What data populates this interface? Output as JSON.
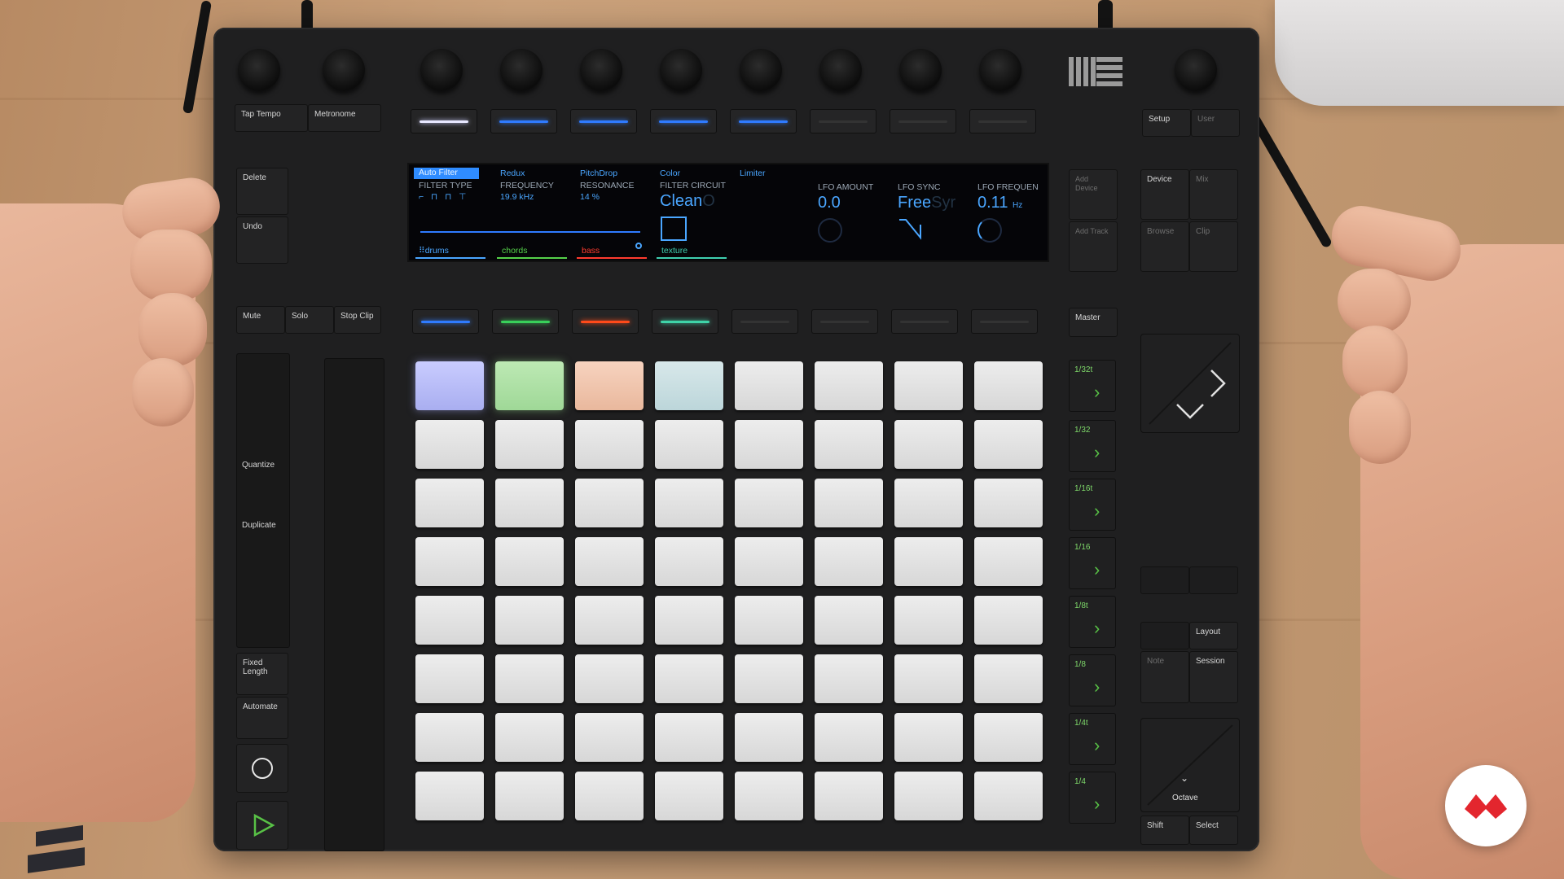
{
  "controller": {
    "top_left_buttons": [
      "Tap Tempo",
      "Metronome"
    ],
    "top_right_buttons": [
      "Setup",
      "User"
    ],
    "left_buttons": [
      "Delete",
      "Undo",
      "Quantize",
      "Duplicate",
      "Fixed Length",
      "Automate"
    ],
    "track_buttons": [
      "Mute",
      "Solo",
      "Stop Clip"
    ],
    "right_buttons": {
      "add_device": "Add Device",
      "add_track": "Add Track",
      "device": "Device",
      "mix": "Mix",
      "browse": "Browse",
      "clip": "Clip",
      "master": "Master",
      "layout": "Layout",
      "note": "Note",
      "session": "Session",
      "octave": "Octave",
      "shift": "Shift",
      "select": "Select"
    },
    "scene_buttons": [
      "1/32t",
      "1/32",
      "1/16t",
      "1/16",
      "1/8t",
      "1/8",
      "1/4t",
      "1/4"
    ],
    "upper_strip_colors": [
      "#e8e8ff",
      "#2f7bff",
      "#2f7bff",
      "#2f7bff",
      "#2f7bff",
      "#333333",
      "#333333",
      "#333333"
    ],
    "lower_strip_colors": [
      "#2f7bff",
      "#39d05a",
      "#ff4a1a",
      "#3fd3a8",
      "#333333",
      "#333333",
      "#333333",
      "#333333"
    ],
    "pad_tints": [
      "#b9bdf6",
      "#a9dea3",
      "#f2c7ae",
      "#c6dbe0"
    ],
    "accent_green": "#58c146"
  },
  "screen": {
    "devices": [
      "Auto Filter",
      "Redux",
      "PitchDrop",
      "Color",
      "Limiter"
    ],
    "params": [
      {
        "label": "FILTER TYPE",
        "value": ""
      },
      {
        "label": "FREQUENCY",
        "value": "19.9 kHz"
      },
      {
        "label": "RESONANCE",
        "value": "14 %"
      },
      {
        "label": "FILTER CIRCUIT",
        "value": "Clean"
      },
      {
        "label": "LFO AMOUNT",
        "value": "0.0"
      },
      {
        "label": "LFO SYNC",
        "value": "Free"
      },
      {
        "label": "LFO FREQUEN",
        "value": "0.11"
      }
    ],
    "ghost_text_1": "O",
    "ghost_text_2": "Syr",
    "freq_unit": "Hz",
    "tracks": [
      {
        "name": "drums",
        "color": "#4aa6ff"
      },
      {
        "name": "chords",
        "color": "#55d24a"
      },
      {
        "name": "bass",
        "color": "#ff3b2f"
      },
      {
        "name": "texture",
        "color": "#3fcfb0"
      }
    ]
  }
}
